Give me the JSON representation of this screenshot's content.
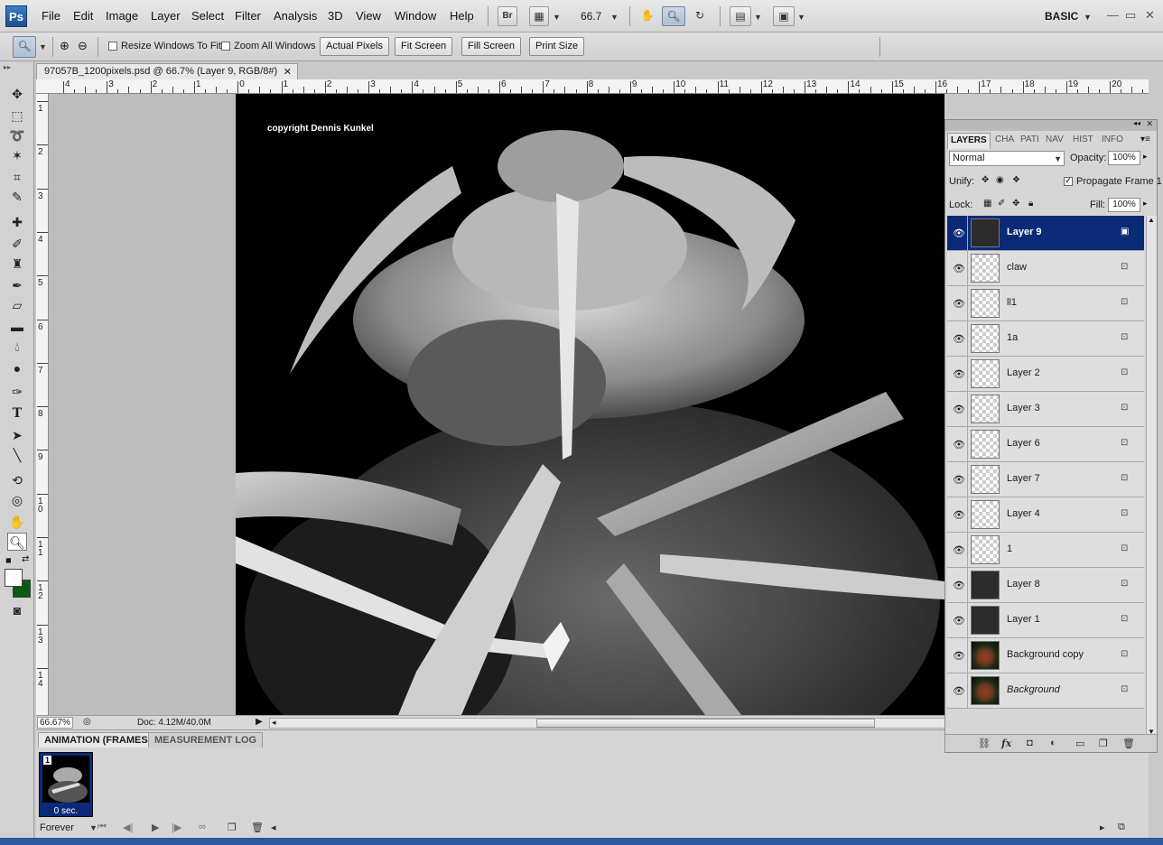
{
  "app": {
    "logo": "Ps",
    "menus": [
      "File",
      "Edit",
      "Image",
      "Layer",
      "Select",
      "Filter",
      "Analysis",
      "3D",
      "View",
      "Window",
      "Help"
    ],
    "bridge_label": "Br",
    "zoom_level": "66.7",
    "workspace": "BASIC"
  },
  "options_bar": {
    "resize_windows": "Resize Windows To Fit",
    "zoom_all": "Zoom All Windows",
    "actual_pixels": "Actual Pixels",
    "fit_screen": "Fit Screen",
    "fill_screen": "Fill Screen",
    "print_size": "Print Size"
  },
  "document": {
    "tab_title": "97057B_1200pixels.psd @ 66.7% (Layer 9, RGB/8#)",
    "copyright": "copyright Dennis Kunkel",
    "ruler_h": [
      "4",
      "3",
      "2",
      "1",
      "0",
      "1",
      "2",
      "3",
      "4",
      "5",
      "6",
      "7",
      "8",
      "9",
      "10",
      "11",
      "12",
      "13",
      "14",
      "15",
      "16",
      "17",
      "18",
      "19",
      "20"
    ],
    "ruler_v": [
      "1",
      "2",
      "3",
      "4",
      "5",
      "6",
      "7",
      "8",
      "9",
      "10",
      "11",
      "12",
      "13",
      "14"
    ]
  },
  "status": {
    "zoom": "66.67%",
    "doc_size": "Doc: 4.12M/40.0M"
  },
  "animation": {
    "tabs": [
      "ANIMATION (FRAMES)",
      "MEASUREMENT LOG"
    ],
    "frame_number": "1",
    "frame_delay": "0 sec.",
    "loop": "Forever"
  },
  "layers_panel": {
    "tabs": [
      "LAYERS",
      "CHA",
      "PATI",
      "NAV",
      "HIST",
      "INFO"
    ],
    "blend_mode": "Normal",
    "opacity_label": "Opacity:",
    "opacity": "100%",
    "unify_label": "Unify:",
    "propagate_label": "Propagate Frame 1",
    "lock_label": "Lock:",
    "fill_label": "Fill:",
    "fill": "100%",
    "layers": [
      {
        "name": "Layer 9",
        "selected": true,
        "thumb": "dark"
      },
      {
        "name": "claw",
        "thumb": "transparent"
      },
      {
        "name": "ll1",
        "thumb": "transparent"
      },
      {
        "name": "1a",
        "thumb": "transparent"
      },
      {
        "name": "Layer 2",
        "thumb": "transparent"
      },
      {
        "name": "Layer 3",
        "thumb": "transparent"
      },
      {
        "name": "Layer 6",
        "thumb": "transparent"
      },
      {
        "name": "Layer 7",
        "thumb": "transparent"
      },
      {
        "name": "Layer 4",
        "thumb": "transparent"
      },
      {
        "name": "1",
        "thumb": "transparent"
      },
      {
        "name": "Layer 8",
        "thumb": "dark"
      },
      {
        "name": "Layer 1",
        "thumb": "dark"
      },
      {
        "name": "Background copy",
        "thumb": "color"
      },
      {
        "name": "Background",
        "thumb": "color",
        "italic": true
      }
    ]
  },
  "colors": {
    "selection": "#0a2a78",
    "foreground_swatch": "#ffffff",
    "background_swatch": "#0b5a14"
  }
}
